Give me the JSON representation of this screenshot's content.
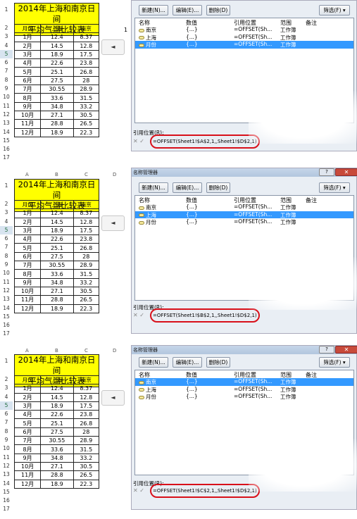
{
  "sheet": {
    "col_headers": [
      "A",
      "B",
      "C",
      "D"
    ],
    "title_line1": "2014年上海和南京日间",
    "title_line2": "平均气温比较表",
    "headers": [
      "月份",
      "上海",
      "南京"
    ],
    "rows": [
      [
        "1月",
        "12.4",
        "8.37"
      ],
      [
        "2月",
        "14.5",
        "12.8"
      ],
      [
        "3月",
        "18.9",
        "17.5"
      ],
      [
        "4月",
        "22.6",
        "23.8"
      ],
      [
        "5月",
        "25.1",
        "26.8"
      ],
      [
        "6月",
        "27.5",
        "28"
      ],
      [
        "7月",
        "30.55",
        "28.9"
      ],
      [
        "8月",
        "33.6",
        "31.5"
      ],
      [
        "9月",
        "34.8",
        "33.2"
      ],
      [
        "10月",
        "27.1",
        "30.5"
      ],
      [
        "11月",
        "28.8",
        "26.5"
      ],
      [
        "12月",
        "18.9",
        "22.3"
      ]
    ],
    "row_numbers": [
      "1",
      "2",
      "3",
      "4",
      "5",
      "6",
      "7",
      "8",
      "9",
      "10",
      "11",
      "12",
      "13",
      "14",
      "15",
      "16",
      "17"
    ],
    "cell_one": "1",
    "nav_arrow": "◄"
  },
  "dialog": {
    "title": "名称管理器",
    "help_btn": "?",
    "close_btn": "✕",
    "new_btn": "新建(N)...",
    "edit_btn": "编辑(E)...",
    "delete_btn": "删除(D)",
    "filter_btn": "筛选(F) ▾",
    "col_name": "名称",
    "col_value": "数值",
    "col_ref": "引用位置",
    "col_scope": "范围",
    "col_note": "备注",
    "ref_label": "引用位置(R):",
    "ref_symbols": "✕ ✓",
    "items": [
      {
        "name": "南京",
        "value": "{...}",
        "ref": "=OFFSET(Sh...",
        "scope": "工作簿"
      },
      {
        "name": "上海",
        "value": "{...}",
        "ref": "=OFFSET(Sh...",
        "scope": "工作簿"
      },
      {
        "name": "月份",
        "value": "{...}",
        "ref": "=OFFSET(Sh...",
        "scope": "工作簿"
      }
    ]
  },
  "panels": [
    {
      "selected_index": 2,
      "formula": "=OFFSET(Sheet1!$A$2,1,,Sheet1!$D$2,1)"
    },
    {
      "selected_index": 1,
      "formula": "=OFFSET(Sheet1!$B$2,1,,Sheet1!$D$2,1)"
    },
    {
      "selected_index": 0,
      "formula": "=OFFSET(Sheet1!$C$2,1,,Sheet1!$D$2,1)"
    }
  ]
}
